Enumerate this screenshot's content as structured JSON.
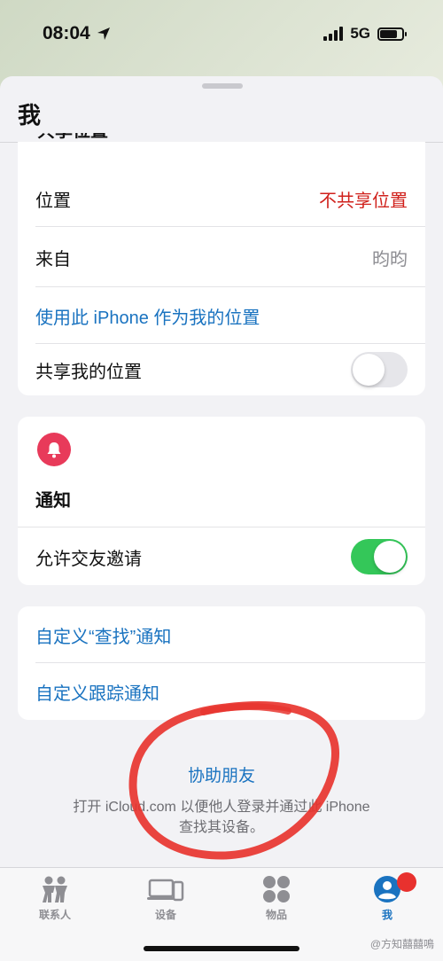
{
  "status": {
    "time": "08:04",
    "network": "5G"
  },
  "sheet": {
    "title": "我",
    "partial_header": "共享位置"
  },
  "location_group": {
    "location_label": "位置",
    "location_value": "不共享位置",
    "from_label": "来自",
    "from_value": "昀昀",
    "use_iphone": "使用此 iPhone 作为我的位置",
    "share_label": "共享我的位置",
    "share_on": false
  },
  "notify_group": {
    "title": "通知",
    "allow_label": "允许交友邀请",
    "allow_on": true
  },
  "custom_group": {
    "custom_find": "自定义“查找”通知",
    "custom_tracking": "自定义跟踪通知"
  },
  "help": {
    "title": "协助朋友",
    "desc_line1": "打开 iCloud.com 以便他人登录并通过此 iPhone",
    "desc_line2": "查找其设备。"
  },
  "tabs": [
    {
      "label": "联系人",
      "icon": "people-icon"
    },
    {
      "label": "设备",
      "icon": "devices-icon"
    },
    {
      "label": "物品",
      "icon": "items-icon"
    },
    {
      "label": "我",
      "icon": "me-icon"
    }
  ],
  "watermark": "@方知囍囍鳴",
  "colors": {
    "accent": "#1a73c0",
    "red": "#d0211c",
    "toggle_on": "#34c759",
    "bell": "#e83a5a"
  }
}
